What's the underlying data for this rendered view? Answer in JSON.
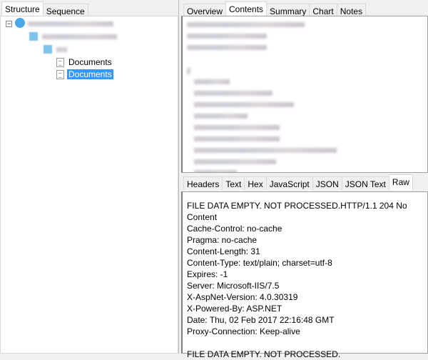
{
  "left_tabs": [
    {
      "label": "Structure",
      "active": true
    },
    {
      "label": "Sequence",
      "active": false
    }
  ],
  "tree": {
    "items": [
      {
        "label": "Documents",
        "selected": false
      },
      {
        "label": "Documents",
        "selected": true
      }
    ]
  },
  "top_tabs": [
    {
      "label": "Overview"
    },
    {
      "label": "Contents",
      "active": true
    },
    {
      "label": "Summary"
    },
    {
      "label": "Chart"
    },
    {
      "label": "Notes"
    }
  ],
  "bottom_tabs": [
    {
      "label": "Headers"
    },
    {
      "label": "Text"
    },
    {
      "label": "Hex"
    },
    {
      "label": "JavaScript"
    },
    {
      "label": "JSON"
    },
    {
      "label": "JSON Text"
    },
    {
      "label": "Raw",
      "active": true
    }
  ],
  "raw_lines": [
    "FILE DATA EMPTY. NOT PROCESSED.HTTP/1.1 204 No Content",
    "Cache-Control: no-cache",
    "Pragma: no-cache",
    "Content-Length: 31",
    "Content-Type: text/plain; charset=utf-8",
    "Expires: -1",
    "Server: Microsoft-IIS/7.5",
    "X-AspNet-Version: 4.0.30319",
    "X-Powered-By: ASP.NET",
    "Date: Thu, 02 Feb 2017 22:16:48 GMT",
    "Proxy-Connection: Keep-alive",
    "",
    "FILE DATA EMPTY. NOT PROCESSED."
  ]
}
